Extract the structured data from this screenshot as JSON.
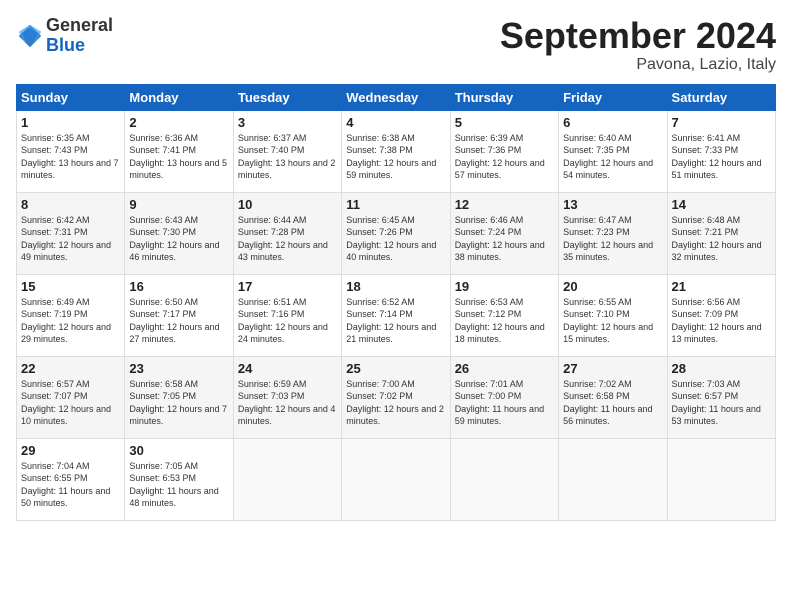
{
  "logo": {
    "general": "General",
    "blue": "Blue"
  },
  "title": "September 2024",
  "subtitle": "Pavona, Lazio, Italy",
  "headers": [
    "Sunday",
    "Monday",
    "Tuesday",
    "Wednesday",
    "Thursday",
    "Friday",
    "Saturday"
  ],
  "weeks": [
    [
      {
        "day": "1",
        "sunrise": "6:35 AM",
        "sunset": "7:43 PM",
        "daylight": "13 hours and 7 minutes."
      },
      {
        "day": "2",
        "sunrise": "6:36 AM",
        "sunset": "7:41 PM",
        "daylight": "13 hours and 5 minutes."
      },
      {
        "day": "3",
        "sunrise": "6:37 AM",
        "sunset": "7:40 PM",
        "daylight": "13 hours and 2 minutes."
      },
      {
        "day": "4",
        "sunrise": "6:38 AM",
        "sunset": "7:38 PM",
        "daylight": "12 hours and 59 minutes."
      },
      {
        "day": "5",
        "sunrise": "6:39 AM",
        "sunset": "7:36 PM",
        "daylight": "12 hours and 57 minutes."
      },
      {
        "day": "6",
        "sunrise": "6:40 AM",
        "sunset": "7:35 PM",
        "daylight": "12 hours and 54 minutes."
      },
      {
        "day": "7",
        "sunrise": "6:41 AM",
        "sunset": "7:33 PM",
        "daylight": "12 hours and 51 minutes."
      }
    ],
    [
      {
        "day": "8",
        "sunrise": "6:42 AM",
        "sunset": "7:31 PM",
        "daylight": "12 hours and 49 minutes."
      },
      {
        "day": "9",
        "sunrise": "6:43 AM",
        "sunset": "7:30 PM",
        "daylight": "12 hours and 46 minutes."
      },
      {
        "day": "10",
        "sunrise": "6:44 AM",
        "sunset": "7:28 PM",
        "daylight": "12 hours and 43 minutes."
      },
      {
        "day": "11",
        "sunrise": "6:45 AM",
        "sunset": "7:26 PM",
        "daylight": "12 hours and 40 minutes."
      },
      {
        "day": "12",
        "sunrise": "6:46 AM",
        "sunset": "7:24 PM",
        "daylight": "12 hours and 38 minutes."
      },
      {
        "day": "13",
        "sunrise": "6:47 AM",
        "sunset": "7:23 PM",
        "daylight": "12 hours and 35 minutes."
      },
      {
        "day": "14",
        "sunrise": "6:48 AM",
        "sunset": "7:21 PM",
        "daylight": "12 hours and 32 minutes."
      }
    ],
    [
      {
        "day": "15",
        "sunrise": "6:49 AM",
        "sunset": "7:19 PM",
        "daylight": "12 hours and 29 minutes."
      },
      {
        "day": "16",
        "sunrise": "6:50 AM",
        "sunset": "7:17 PM",
        "daylight": "12 hours and 27 minutes."
      },
      {
        "day": "17",
        "sunrise": "6:51 AM",
        "sunset": "7:16 PM",
        "daylight": "12 hours and 24 minutes."
      },
      {
        "day": "18",
        "sunrise": "6:52 AM",
        "sunset": "7:14 PM",
        "daylight": "12 hours and 21 minutes."
      },
      {
        "day": "19",
        "sunrise": "6:53 AM",
        "sunset": "7:12 PM",
        "daylight": "12 hours and 18 minutes."
      },
      {
        "day": "20",
        "sunrise": "6:55 AM",
        "sunset": "7:10 PM",
        "daylight": "12 hours and 15 minutes."
      },
      {
        "day": "21",
        "sunrise": "6:56 AM",
        "sunset": "7:09 PM",
        "daylight": "12 hours and 13 minutes."
      }
    ],
    [
      {
        "day": "22",
        "sunrise": "6:57 AM",
        "sunset": "7:07 PM",
        "daylight": "12 hours and 10 minutes."
      },
      {
        "day": "23",
        "sunrise": "6:58 AM",
        "sunset": "7:05 PM",
        "daylight": "12 hours and 7 minutes."
      },
      {
        "day": "24",
        "sunrise": "6:59 AM",
        "sunset": "7:03 PM",
        "daylight": "12 hours and 4 minutes."
      },
      {
        "day": "25",
        "sunrise": "7:00 AM",
        "sunset": "7:02 PM",
        "daylight": "12 hours and 2 minutes."
      },
      {
        "day": "26",
        "sunrise": "7:01 AM",
        "sunset": "7:00 PM",
        "daylight": "11 hours and 59 minutes."
      },
      {
        "day": "27",
        "sunrise": "7:02 AM",
        "sunset": "6:58 PM",
        "daylight": "11 hours and 56 minutes."
      },
      {
        "day": "28",
        "sunrise": "7:03 AM",
        "sunset": "6:57 PM",
        "daylight": "11 hours and 53 minutes."
      }
    ],
    [
      {
        "day": "29",
        "sunrise": "7:04 AM",
        "sunset": "6:55 PM",
        "daylight": "11 hours and 50 minutes."
      },
      {
        "day": "30",
        "sunrise": "7:05 AM",
        "sunset": "6:53 PM",
        "daylight": "11 hours and 48 minutes."
      },
      null,
      null,
      null,
      null,
      null
    ]
  ],
  "labels": {
    "sunrise": "Sunrise:",
    "sunset": "Sunset:",
    "daylight": "Daylight:"
  }
}
